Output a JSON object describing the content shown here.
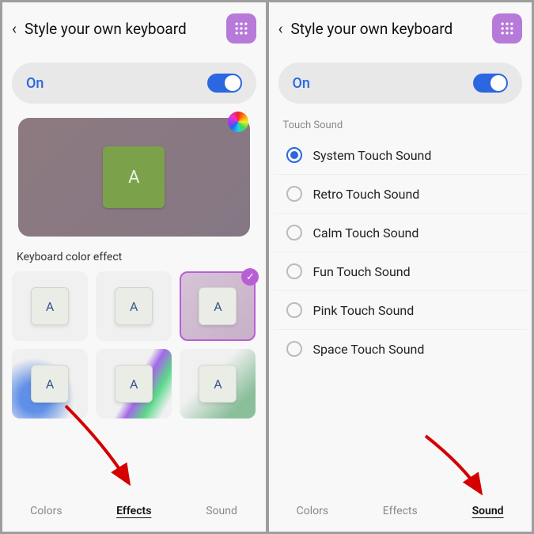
{
  "header": {
    "title": "Style your own keyboard"
  },
  "toggle": {
    "label": "On"
  },
  "effects": {
    "section_label": "Keyboard color effect",
    "preview_letter": "A",
    "key_letter": "A"
  },
  "sound": {
    "section_label": "Touch Sound",
    "options": [
      "System Touch Sound",
      "Retro Touch Sound",
      "Calm Touch Sound",
      "Fun Touch Sound",
      "Pink Touch Sound",
      "Space Touch Sound"
    ]
  },
  "tabs": {
    "colors": "Colors",
    "effects": "Effects",
    "sound": "Sound"
  }
}
